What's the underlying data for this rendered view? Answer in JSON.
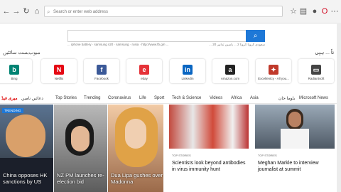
{
  "browser": {
    "address_placeholder": "Search or enter web address",
    "tab_count": "1"
  },
  "search": {
    "trending_left": "... iphone battery · samsung s20 · samsung · rusia · http://www.fb.gm ...",
    "trending_right": "... سعودی کرونا کرونا 2 ... یاسین تدابیر 20"
  },
  "sites": {
    "header_left": "مبوب‌بست سائٹیں",
    "header_right": "ناً ... ہیں",
    "tiles": [
      {
        "label": "Bing",
        "icon": "b",
        "color": "#008373"
      },
      {
        "label": "Netflix",
        "icon": "N",
        "color": "#e50914"
      },
      {
        "label": "Facebook",
        "icon": "f",
        "color": "#3b5998"
      },
      {
        "label": "ebay",
        "icon": "e",
        "color": "#e53238"
      },
      {
        "label": "LinkedIn",
        "icon": "in",
        "color": "#0a66c2"
      },
      {
        "label": "Amazon.com",
        "icon": "a",
        "color": "#222"
      },
      {
        "label": "Excellentcy - All you...",
        "icon": "✦",
        "color": "#c0392b"
      },
      {
        "label": "Radiantsoft",
        "icon": "▭",
        "color": "#444"
      }
    ]
  },
  "news": {
    "tabs_left": [
      "میری فیڈ",
      "دعائیں نامیں"
    ],
    "tabs": [
      "Top Stories",
      "Trending",
      "Coronavirus",
      "Life",
      "Sport",
      "Tech & Science",
      "Videos",
      "Africa",
      "Asia"
    ],
    "news_label": "Microsoft News",
    "news_label_urdu": "بلوما خان"
  },
  "cards": [
    {
      "badge": "TRENDING",
      "caption": "China opposes HK sanctions by US"
    },
    {
      "caption": "NZ PM launches re-election bid"
    },
    {
      "caption": "Dua Lipa gushes over Madonna"
    },
    {
      "tag": "TOP STORIES",
      "caption": "Scientists look beyond antibodies in virus immunity hunt"
    },
    {
      "tag": "TOP STORIES",
      "caption": "Meghan Markle to interview journalist at summit"
    }
  ]
}
